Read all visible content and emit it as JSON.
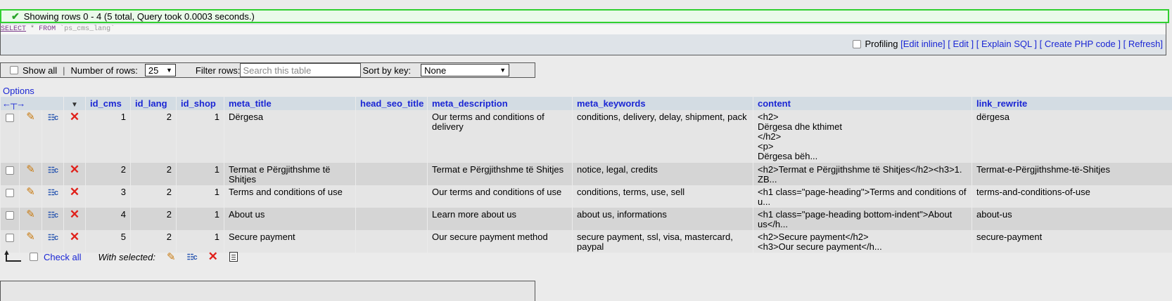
{
  "message": {
    "text": "Showing rows 0 - 4 (5 total, Query took 0.0003 seconds.)"
  },
  "sql": {
    "select_kw": "SELECT",
    "star": "*",
    "from_kw": "FROM",
    "table": "`ps_cms_lang`"
  },
  "query_actions": {
    "profiling": "Profiling",
    "edit_inline": "[Edit inline]",
    "edit": "[ Edit ]",
    "explain": "[ Explain SQL ]",
    "create_php": "[ Create PHP code ]",
    "refresh": "[ Refresh]"
  },
  "navigation": {
    "show_all": "Show all",
    "separator": "|",
    "rows_label": "Number of rows:",
    "rows_value": "25",
    "filter_label": "Filter rows:",
    "filter_placeholder": "Search this table",
    "sort_label": "Sort by key:",
    "sort_value": "None"
  },
  "options_label": "Options",
  "columns": [
    "id_cms",
    "id_lang",
    "id_shop",
    "meta_title",
    "head_seo_title",
    "meta_description",
    "meta_keywords",
    "content",
    "link_rewrite"
  ],
  "rows": [
    {
      "id_cms": "1",
      "id_lang": "2",
      "id_shop": "1",
      "meta_title": "Dërgesa",
      "head_seo_title": "",
      "meta_description": "Our terms and conditions of delivery",
      "meta_keywords": "conditions, delivery, delay, shipment, pack",
      "content": [
        "<h2>",
        "Dërgesa dhe kthimet",
        "</h2>",
        "<p>",
        "Dërgesa bëh..."
      ],
      "link_rewrite": "dërgesa"
    },
    {
      "id_cms": "2",
      "id_lang": "2",
      "id_shop": "1",
      "meta_title": "Termat e Përgjithshme të Shitjes",
      "head_seo_title": "",
      "meta_description": "Termat e Përgjithshme të Shitjes",
      "meta_keywords": "notice, legal, credits",
      "content": [
        "<h2>Termat e Përgjithshme të Shitjes</h2><h3>1. ZB..."
      ],
      "link_rewrite": "Termat-e-Përgjithshme-të-Shitjes"
    },
    {
      "id_cms": "3",
      "id_lang": "2",
      "id_shop": "1",
      "meta_title": "Terms and conditions of use",
      "head_seo_title": "",
      "meta_description": "Our terms and conditions of use",
      "meta_keywords": "conditions, terms, use, sell",
      "content": [
        "<h1 class=\"page-heading\">Terms and conditions of u..."
      ],
      "link_rewrite": "terms-and-conditions-of-use"
    },
    {
      "id_cms": "4",
      "id_lang": "2",
      "id_shop": "1",
      "meta_title": "About us",
      "head_seo_title": "",
      "meta_description": "Learn more about us",
      "meta_keywords": "about us, informations",
      "content": [
        "<h1 class=\"page-heading bottom-indent\">About us</h..."
      ],
      "link_rewrite": "about-us"
    },
    {
      "id_cms": "5",
      "id_lang": "2",
      "id_shop": "1",
      "meta_title": "Secure payment",
      "head_seo_title": "",
      "meta_description": "Our secure payment method",
      "meta_keywords": "secure payment, ssl, visa, mastercard, paypal",
      "content": [
        "<h2>Secure payment</h2>",
        "<h3>Our secure payment</h..."
      ],
      "link_rewrite": "secure-payment"
    }
  ],
  "footer": {
    "check_all": "Check all",
    "with_selected": "With selected:"
  },
  "icons": {
    "success": "check-icon",
    "edit": "pencil-icon",
    "copy": "copy-row-icon",
    "delete": "delete-icon",
    "export": "export-icon"
  },
  "colors": {
    "link": "#1a26d4",
    "success_border": "#30d030",
    "header_bg": "#d3dce3",
    "delete": "#e0201a"
  }
}
